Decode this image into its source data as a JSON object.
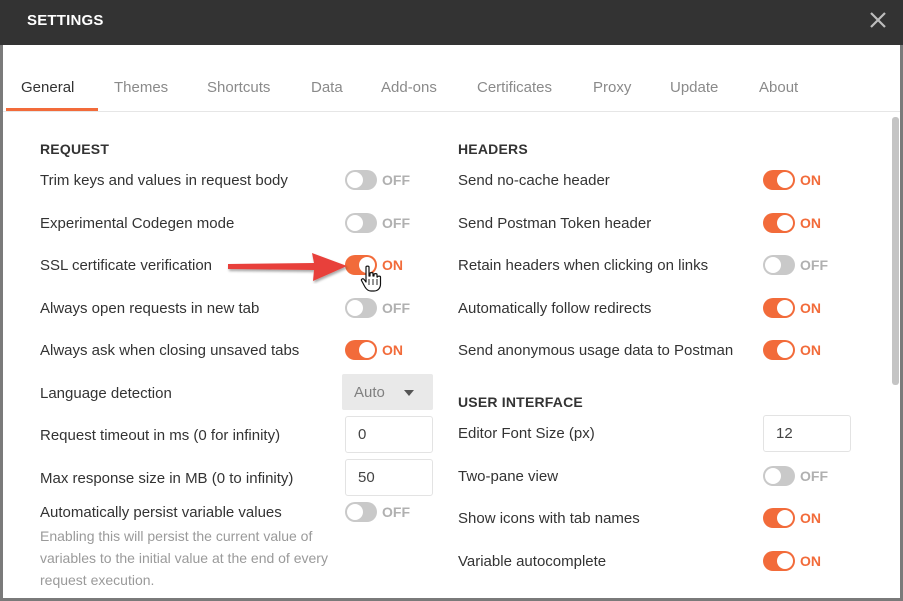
{
  "window": {
    "title": "SETTINGS"
  },
  "tabs": [
    {
      "label": "General",
      "active": true
    },
    {
      "label": "Themes"
    },
    {
      "label": "Shortcuts"
    },
    {
      "label": "Data"
    },
    {
      "label": "Add-ons"
    },
    {
      "label": "Certificates"
    },
    {
      "label": "Proxy"
    },
    {
      "label": "Update"
    },
    {
      "label": "About"
    }
  ],
  "request": {
    "title": "REQUEST",
    "items": [
      {
        "label": "Trim keys and values in request body",
        "state": "OFF"
      },
      {
        "label": "Experimental Codegen mode",
        "state": "OFF"
      },
      {
        "label": "SSL certificate verification",
        "state": "ON"
      },
      {
        "label": "Always open requests in new tab",
        "state": "OFF"
      },
      {
        "label": "Always ask when closing unsaved tabs",
        "state": "ON"
      }
    ],
    "language_detection": {
      "label": "Language detection",
      "value": "Auto"
    },
    "timeout": {
      "label": "Request timeout in ms (0 for infinity)",
      "value": "0"
    },
    "max_response": {
      "label": "Max response size in MB (0 to infinity)",
      "value": "50"
    },
    "persist": {
      "label": "Automatically persist variable values",
      "state": "OFF",
      "description": "Enabling this will persist the current value of variables to the initial value at the end of every request execution."
    }
  },
  "headers": {
    "title": "HEADERS",
    "items": [
      {
        "label": "Send no-cache header",
        "state": "ON"
      },
      {
        "label": "Send Postman Token header",
        "state": "ON"
      },
      {
        "label": "Retain headers when clicking on links",
        "state": "OFF"
      },
      {
        "label": "Automatically follow redirects",
        "state": "ON"
      },
      {
        "label": "Send anonymous usage data to Postman",
        "state": "ON"
      }
    ]
  },
  "user_interface": {
    "title": "USER INTERFACE",
    "font_size": {
      "label": "Editor Font Size (px)",
      "value": "12"
    },
    "items": [
      {
        "label": "Two-pane view",
        "state": "OFF"
      },
      {
        "label": "Show icons with tab names",
        "state": "ON"
      },
      {
        "label": "Variable autocomplete",
        "state": "ON"
      }
    ]
  },
  "colors": {
    "accent": "#f26b3a",
    "titlebar": "#333333",
    "arrow": "#e8413a"
  }
}
